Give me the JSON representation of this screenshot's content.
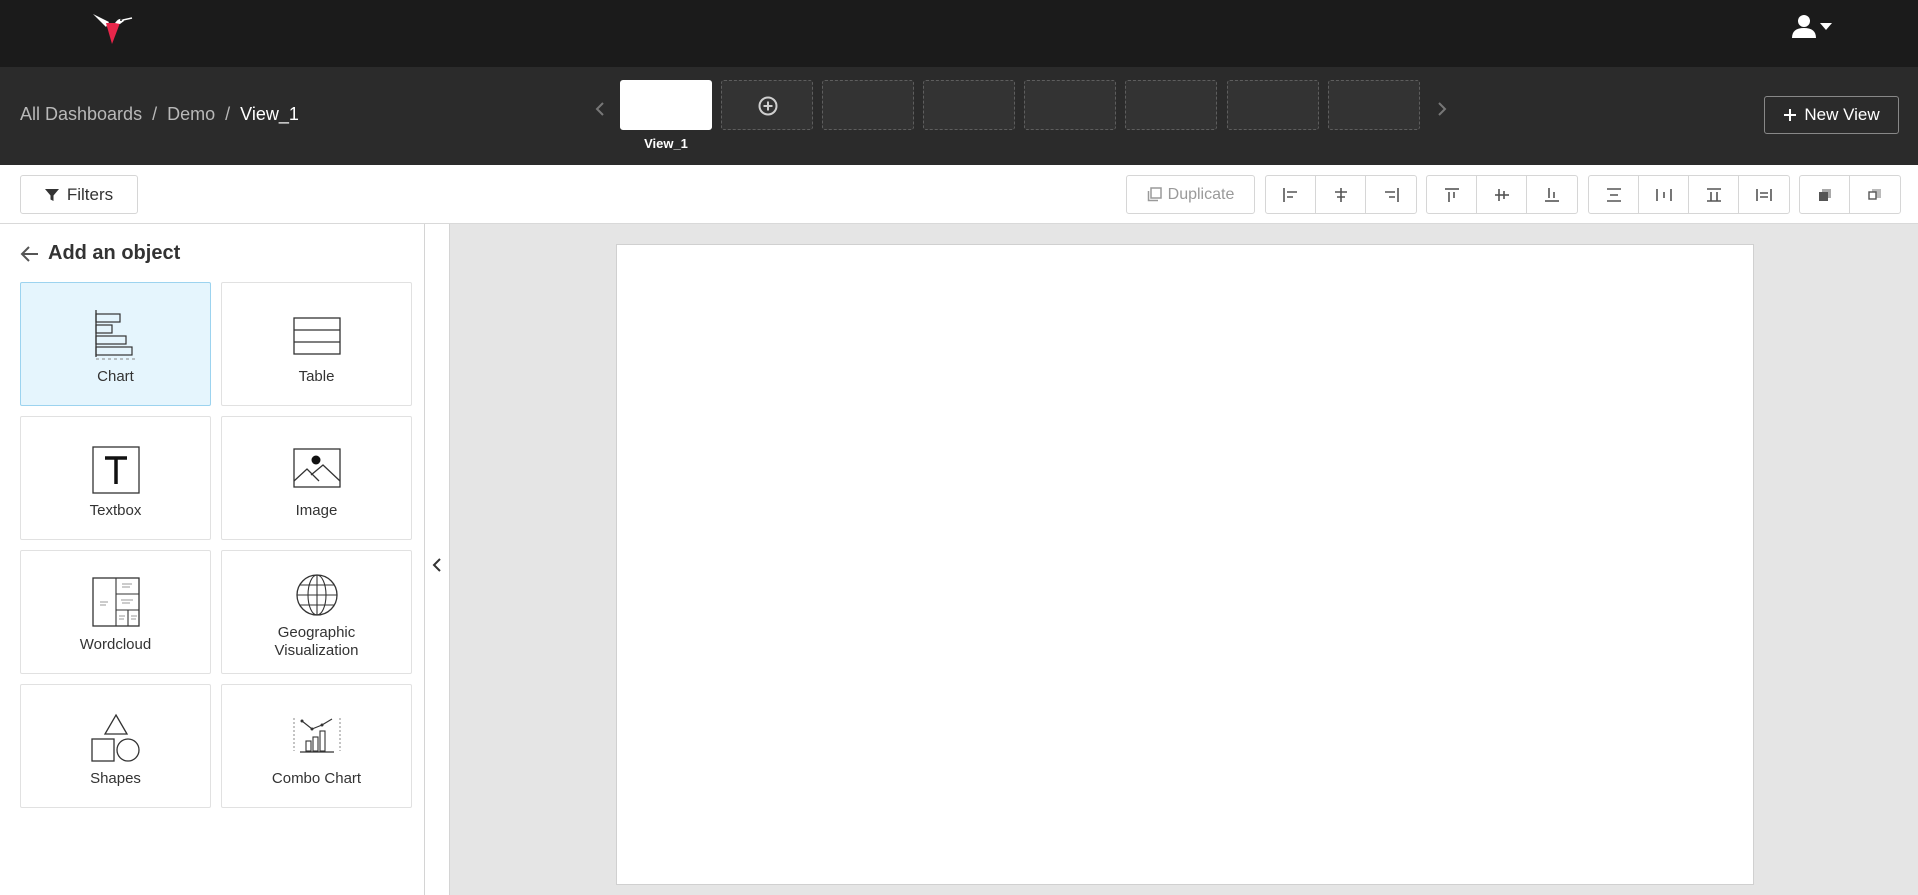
{
  "header": {
    "logo_icon": "hummingbird-logo-icon",
    "user_icon": "user-icon",
    "user_menu_caret": "caret-down-icon"
  },
  "breadcrumb": {
    "items": [
      "All Dashboards",
      "Demo"
    ],
    "separator": "/",
    "current": "View_1"
  },
  "views": {
    "active_label": "View_1",
    "add_icon": "plus-circle-icon",
    "prev_icon": "chevron-left-icon",
    "next_icon": "chevron-right-icon"
  },
  "new_view": {
    "label": "New View",
    "icon": "plus-icon"
  },
  "toolbar": {
    "filters_label": "Filters",
    "filter_icon": "funnel-icon",
    "duplicate_label": "Duplicate",
    "duplicate_icon": "copy-icon"
  },
  "sidebar": {
    "title": "Add an object",
    "back_icon": "arrow-left-icon",
    "objects": [
      {
        "label": "Chart",
        "icon": "bar-chart-icon",
        "selected": true
      },
      {
        "label": "Table",
        "icon": "table-icon"
      },
      {
        "label": "Textbox",
        "icon": "textbox-icon"
      },
      {
        "label": "Image",
        "icon": "image-icon"
      },
      {
        "label": "Wordcloud",
        "icon": "wordcloud-icon"
      },
      {
        "label": "Geographic",
        "label_line2": "Visualization",
        "icon": "globe-icon"
      },
      {
        "label": "Shapes",
        "icon": "shapes-icon"
      },
      {
        "label": "Combo Chart",
        "icon": "combo-chart-icon"
      }
    ],
    "collapse_icon": "chevron-left-icon"
  },
  "colors": {
    "topbar": "#1b1b1b",
    "subbar": "#2b2b2b",
    "accent_red": "#e8264a",
    "selected_tile_bg": "#e5f5fd",
    "canvas_bg": "#e5e5e5"
  }
}
